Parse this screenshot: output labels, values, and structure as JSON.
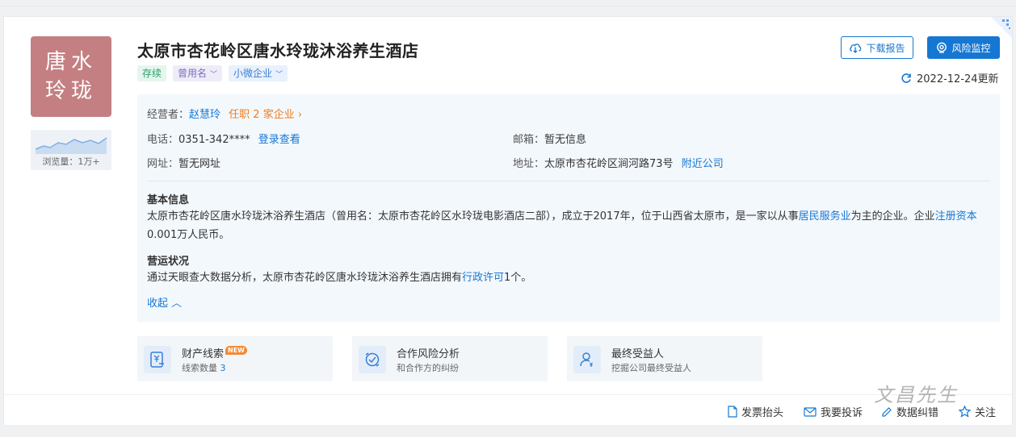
{
  "company": {
    "logo_line1": "唐水",
    "logo_line2": "玲珑",
    "name": "太原市杏花岭区唐水玲珑沐浴养生酒店",
    "views_label": "浏览量：1万+"
  },
  "tags": [
    {
      "label": "存续"
    },
    {
      "label": "曾用名"
    },
    {
      "label": "小微企业"
    }
  ],
  "actions": {
    "download_label": "下载报告",
    "monitor_label": "风险监控",
    "updated_text": "2022-12-24更新"
  },
  "info": {
    "operator_label": "经营者：",
    "operator_name": "赵慧玲",
    "operator_positions": "任职 2 家企业",
    "phone_label": "电话：",
    "phone_value": "0351-342****",
    "phone_link": "登录查看",
    "email_label": "邮箱：",
    "email_value": "暂无信息",
    "website_label": "网址：",
    "website_value": "暂无网址",
    "address_label": "地址：",
    "address_value": "太原市杏花岭区涧河路73号",
    "address_link": "附近公司"
  },
  "basic": {
    "heading": "基本信息",
    "text1": "太原市杏花岭区唐水玲珑沐浴养生酒店（曾用名：太原市杏花岭区水玲珑电影酒店二部），成立于2017年，位于山西省太原市，是一家以从事",
    "link1": "居民服务业",
    "text2": "为主的企业。企业",
    "link2": "注册资本",
    "text3": "0.001万人民币。"
  },
  "operation": {
    "heading": "营运状况",
    "text1": "通过天眼查大数据分析，太原市杏花岭区唐水玲珑沐浴养生酒店拥有",
    "link1": "行政许可",
    "text2": "1个。"
  },
  "collapse_label": "收起",
  "features": [
    {
      "title": "财产线索",
      "badge": "NEW",
      "sub_prefix": "线索数量 ",
      "sub_value": "3"
    },
    {
      "title": "合作风险分析",
      "sub": "和合作方的纠纷"
    },
    {
      "title": "最终受益人",
      "sub": "挖掘公司最终受益人"
    }
  ],
  "bottom": {
    "invoice_label": "发票抬头",
    "complaint_label": "我要投诉",
    "data_label": "数据纠错",
    "follow_label": "关注"
  },
  "watermark": "文昌先生",
  "colors": {
    "primary": "#1677d2",
    "logo_bg": "#c47f82",
    "orange": "#f07b1c",
    "status_green": "#2e9f6b"
  }
}
